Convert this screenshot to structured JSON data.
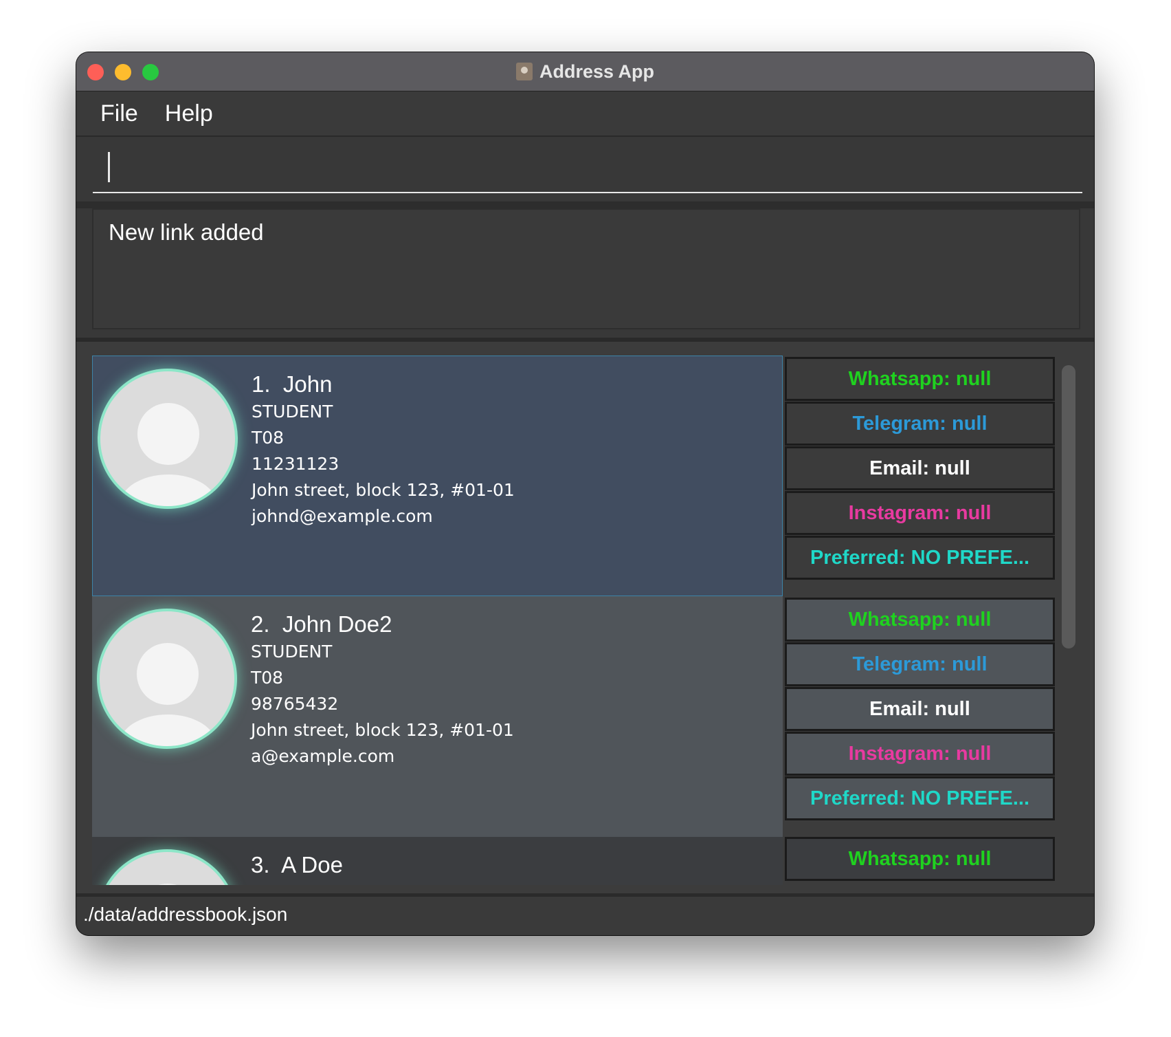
{
  "window": {
    "title": "Address App",
    "app_icon": "address-book-icon"
  },
  "menu": [
    {
      "label": "File"
    },
    {
      "label": "Help"
    }
  ],
  "command_box": {
    "value": "",
    "placeholder": ""
  },
  "result_display": {
    "text": "New link added"
  },
  "persons": [
    {
      "index": "1.",
      "name": "John",
      "role": "STUDENT",
      "tutorial": "T08",
      "phone": "11231123",
      "address": "John street, block 123, #01-01",
      "email": "johnd@example.com",
      "selected": true,
      "links": [
        {
          "text": "Whatsapp: null",
          "color": "#1fd21f"
        },
        {
          "text": "Telegram: null",
          "color": "#2c9ad8"
        },
        {
          "text": "Email: null",
          "color": "#ffffff"
        },
        {
          "text": "Instagram: null",
          "color": "#e83aa0"
        },
        {
          "text": "Preferred: NO PREFE...",
          "color": "#1fd8c8"
        }
      ]
    },
    {
      "index": "2.",
      "name": "John Doe2",
      "role": "STUDENT",
      "tutorial": "T08",
      "phone": "98765432",
      "address": "John street, block 123, #01-01",
      "email": "a@example.com",
      "selected": false,
      "links": [
        {
          "text": "Whatsapp: null",
          "color": "#1fd21f"
        },
        {
          "text": "Telegram: null",
          "color": "#2c9ad8"
        },
        {
          "text": "Email: null",
          "color": "#ffffff"
        },
        {
          "text": "Instagram: null",
          "color": "#e83aa0"
        },
        {
          "text": "Preferred: NO PREFE...",
          "color": "#1fd8c8"
        }
      ]
    },
    {
      "index": "3.",
      "name": "A Doe",
      "selected": false,
      "links": [
        {
          "text": "Whatsapp: null",
          "color": "#1fd21f"
        }
      ]
    }
  ],
  "status_bar": {
    "path": "./data/addressbook.json"
  },
  "colors": {
    "selected_card": "#414d60",
    "card": "#50555a",
    "accent_glow": "#8de6c8"
  }
}
